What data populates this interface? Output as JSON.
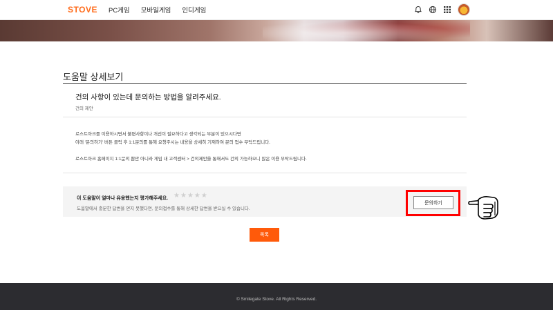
{
  "header": {
    "logo": "STOVE",
    "nav": [
      "PC게임",
      "모바일게임",
      "인디게임"
    ],
    "icons": [
      "bell-icon",
      "globe-icon",
      "grid-menu-icon",
      "avatar"
    ]
  },
  "page": {
    "title": "도움말 상세보기"
  },
  "article": {
    "title": "건의 사항이 있는데 문의하는 방법을 알려주세요.",
    "category": "건의 제안",
    "lines": [
      "로스트아크를 이용하시면서 불편사항이나 개선이 필요하다고 생각되는 부분이 있으시다면",
      "아래 '문의하기' 버튼 클릭 후 1:1문의를 통해 요청주시는 내용을 상세히 기재하여 문의 접수 부탁드립니다.",
      "로스트아크 홈페이지 1:1문의 뿐만 아니라 게임 내 고객센터 > 건의제안을 통해서도 건의 가능하오니 많은 이용 부탁드립니다."
    ]
  },
  "rating": {
    "question": "이 도움말이 얼마나 유용했는지 평가해주세요.",
    "star_count": 5,
    "stars_filled": 0,
    "note": "도움말에서 충분한 답변을 얻지 못했다면, 문의접수를 통해 상세한 답변을 받으실 수 있습니다.",
    "inquiry_button": "문의하기"
  },
  "list_button": "목록",
  "footer": {
    "copyright": "© Smilegate Stove. All Rights Reserved."
  },
  "colors": {
    "brand": "#ff6b1a",
    "list_button": "#ff5a0a",
    "highlight": "#ff0000",
    "footer": "#2c2c30"
  }
}
